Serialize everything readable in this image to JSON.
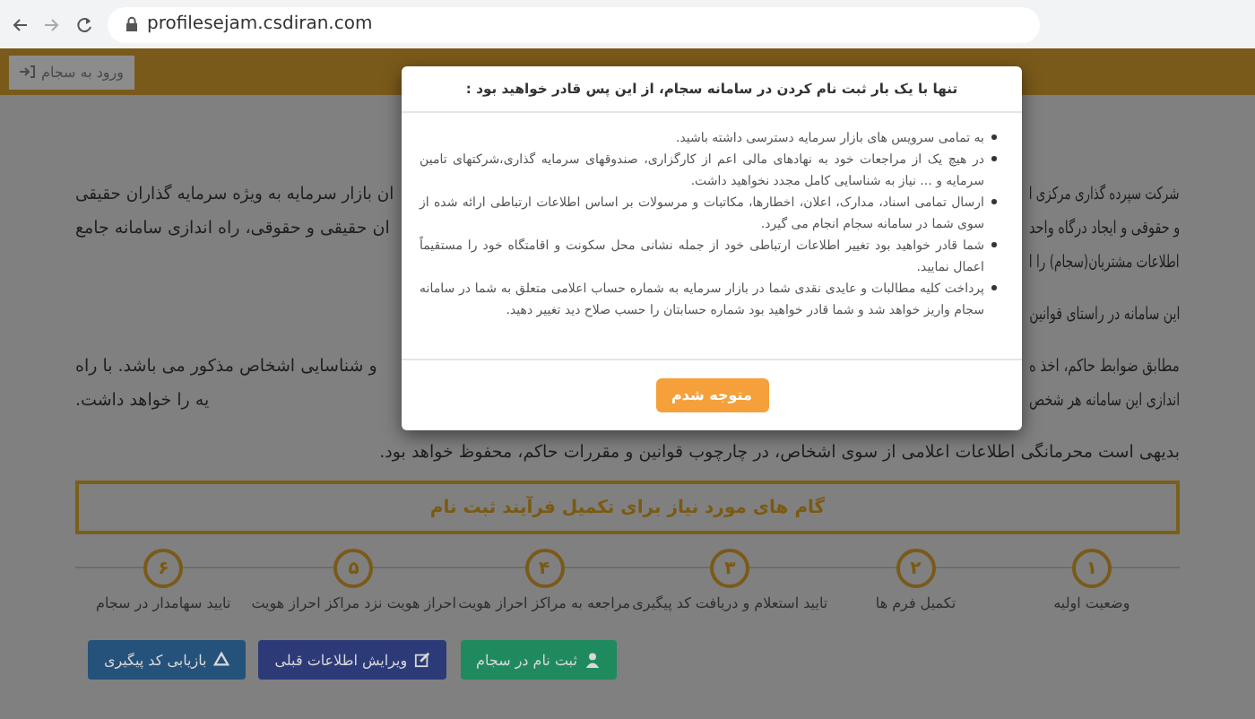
{
  "browser": {
    "url": "profilesejam.csdiran.com"
  },
  "header": {
    "login_button": "ورود به سجام"
  },
  "paragraphs": [
    {
      "lines": [
        {
          "start": "شرکت سپرده گذاری مرکزی ا",
          "end": "ان بازار سرمایه به ویژه سرمایه گذاران حقیقی"
        },
        {
          "start": "و حقوقی و ایجاد درگاه واحد",
          "end": "ان حقیقی و حقوقی، راه اندازی سامانه جامع"
        },
        {
          "start": "اطلاعات مشتریان(سجام) را ا"
        }
      ]
    },
    {
      "lines": [
        {
          "start": "این سامانه در راستای قوانین"
        }
      ]
    },
    {
      "lines": [
        {
          "start": "مطابق ضوابط حاکم، اخذ ه",
          "end": "و شناسایی اشخاص مذکور می باشد. با راه"
        },
        {
          "start": "اندازی این سامانه هر شخص",
          "end": "یه را خواهد داشت."
        }
      ]
    }
  ],
  "closing_paragraph": "بدیهی است محرمانگی اطلاعات اعلامی از سوی اشخاص، در چارچوب قوانین و مقررات حاکم، محفوظ خواهد بود.",
  "steps_heading": "گام های مورد نیاز برای تکمیل فرآیند ثبت نام",
  "steps": [
    {
      "number": "۱",
      "label": "وضعیت اولیه"
    },
    {
      "number": "۲",
      "label": "تکمیل فرم ها"
    },
    {
      "number": "۳",
      "label": "تایید استعلام و دریافت کد پیگیری"
    },
    {
      "number": "۴",
      "label": "مراجعه به مراکز احراز هویت"
    },
    {
      "number": "۵",
      "label": "احراز هویت نزد مراکز احراز هویت"
    },
    {
      "number": "۶",
      "label": "تایید سهامدار در سجام"
    }
  ],
  "actions": [
    {
      "kind": "register",
      "label": "ثبت نام در سجام"
    },
    {
      "kind": "edit",
      "label": "ویرایش اطلاعات قبلی"
    },
    {
      "kind": "recover",
      "label": "بازیابی کد پیگیری"
    }
  ],
  "modal": {
    "title": "تنها با یک بار ثبت نام کردن در سامانه سجام، از این پس قادر خواهید بود :",
    "items": [
      "به تمامی سرویس های بازار سرمایه دسترسی داشته باشید.",
      "در هیچ یک از مراجعات خود به نهادهای مالی اعم از کارگزاری، صندوقهای سرمایه گذاری،شرکتهای تامین سرمایه و ... نیاز به شناسایی کامل مجدد نخواهید داشت.",
      "ارسال تمامی اسناد، مدارک، اعلان، اخطارها، مکاتبات و مرسولات بر اساس اطلاعات ارتباطی ارائه شده از سوی شما در سامانه سجام انجام می گیرد.",
      "شما قادر خواهید بود تغییر اطلاعات ارتباطی خود از جمله نشانی محل سکونت و اقامتگاه خود را مستقیماً اعمال نمایید.",
      "پرداخت کلیه مطالبات و عایدی نقدی شما در بازار سرمایه به شماره حساب اعلامی متعلق به شما در سامانه سجام واریز خواهد شد و شما قادر خواهید بود شماره حسابتان را حسب صلاح دید تغییر دهید."
    ],
    "confirm_button": "متوجه شدم"
  }
}
